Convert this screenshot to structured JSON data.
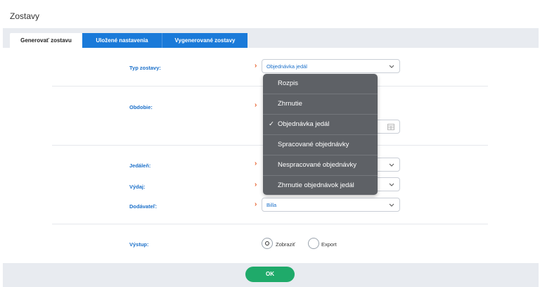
{
  "page": {
    "title": "Zostavy"
  },
  "tabs": [
    {
      "label": "Generovať zostavu",
      "active": true
    },
    {
      "label": "Uložené nastavenia",
      "active": false
    },
    {
      "label": "Vygenerované zostavy",
      "active": false
    }
  ],
  "form": {
    "report_type": {
      "label": "Typ zostavy:",
      "value": "Objednávka jedál"
    },
    "period": {
      "label": "Obdobie:"
    },
    "canteen": {
      "label": "Jedáleň:"
    },
    "dispensary": {
      "label": "Výdaj:"
    },
    "supplier": {
      "label": "Dodávateľ:",
      "value": "Billa"
    },
    "output": {
      "label": "Výstup:",
      "options": [
        "Zobraziť",
        "Export"
      ],
      "selected": "Zobraziť"
    }
  },
  "dropdown": {
    "options": [
      "Rozpis",
      "Zhrnutie",
      "Objednávka jedál",
      "Spracované objednávky",
      "Nespracované objednávky",
      "Zhrnutie objednávok jedál"
    ],
    "selected": "Objednávka jedál",
    "check": "✓"
  },
  "footer": {
    "ok_label": "OK"
  },
  "colors": {
    "accent": "#1a7ad9",
    "ok": "#1faa6a",
    "arrow": "#e8622d",
    "menu": "#5e6166"
  }
}
